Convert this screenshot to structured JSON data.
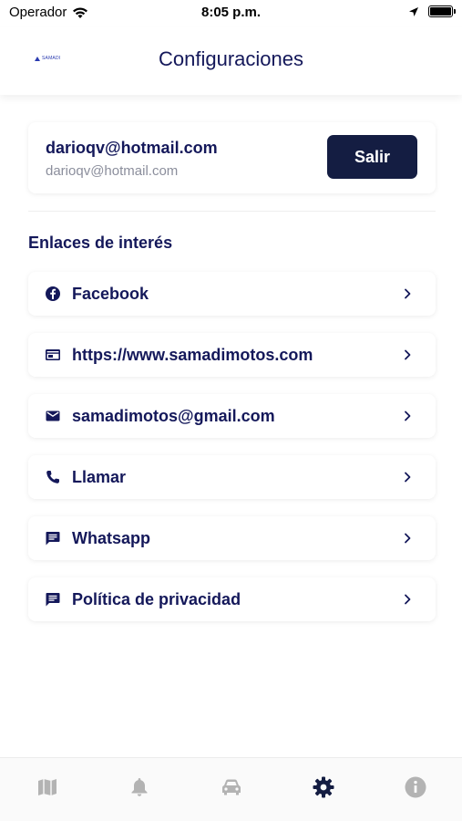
{
  "status_bar": {
    "carrier": "Operador",
    "time": "8:05 p.m."
  },
  "header": {
    "logo_text": "SAMADI",
    "title": "Configuraciones"
  },
  "account": {
    "email": "darioqv@hotmail.com",
    "sub_email": "darioqv@hotmail.com",
    "logout_label": "Salir"
  },
  "links_section": {
    "title": "Enlaces de interés",
    "items": [
      {
        "label": "Facebook",
        "icon": "facebook-icon"
      },
      {
        "label": "https://www.samadimotos.com",
        "icon": "web-icon"
      },
      {
        "label": "samadimotos@gmail.com",
        "icon": "email-icon"
      },
      {
        "label": "Llamar",
        "icon": "phone-icon"
      },
      {
        "label": "Whatsapp",
        "icon": "chat-icon"
      },
      {
        "label": "Política de privacidad",
        "icon": "chat-icon"
      }
    ]
  },
  "tab_bar": {
    "tabs": [
      {
        "icon": "map-icon",
        "active": false
      },
      {
        "icon": "bell-icon",
        "active": false
      },
      {
        "icon": "car-icon",
        "active": false
      },
      {
        "icon": "gear-icon",
        "active": true
      },
      {
        "icon": "info-icon",
        "active": false
      }
    ],
    "active_color": "#141d42",
    "inactive_color": "#b3b3b3"
  },
  "colors": {
    "primary": "#14185a",
    "button": "#141d42",
    "muted": "#8b8e9c"
  }
}
